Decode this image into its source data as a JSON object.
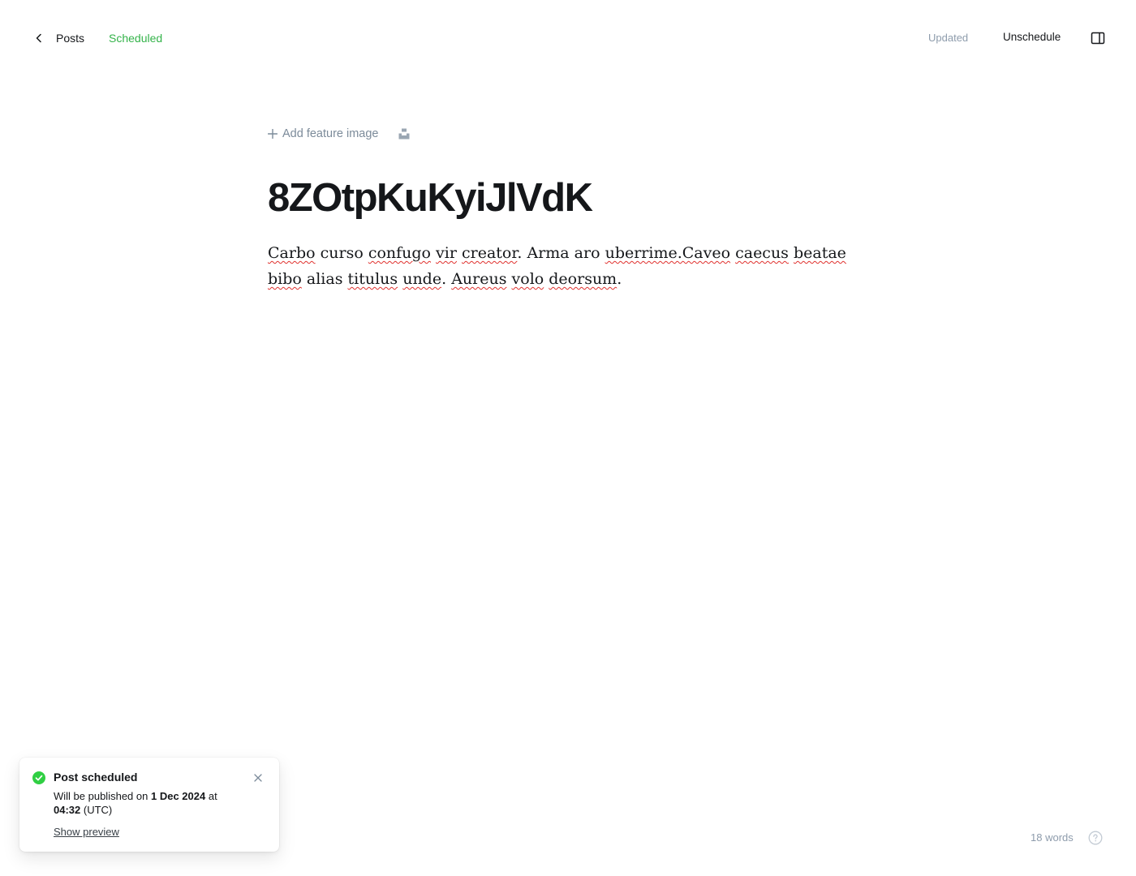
{
  "header": {
    "back_label": "Posts",
    "status": "Scheduled",
    "saved_state": "Updated",
    "unschedule_label": "Unschedule"
  },
  "editor": {
    "add_feature_image_label": "Add feature image",
    "title": "8ZOtpKuKyiJlVdK",
    "body_text": "Carbo curso confugo vir creator. Arma aro uberrime.Caveo caecus beatae bibo alias titulus unde. Aureus volo deorsum."
  },
  "toast": {
    "title": "Post scheduled",
    "message_prefix": "Will be published on",
    "date": "1 Dec 2024",
    "at_word": "at",
    "time": "04:32",
    "timezone": "(UTC)",
    "link_label": "Show preview"
  },
  "footer": {
    "word_count": "18 words"
  },
  "colors": {
    "status_green": "#34b34a",
    "muted": "#8e9cac",
    "text": "#15171a"
  },
  "icons": {
    "back": "chevron-left-icon",
    "settings_toggle": "sidebar-panel-icon",
    "add": "plus-icon",
    "unsplash": "unsplash-icon",
    "toast_status": "check-circle-icon",
    "close": "close-icon",
    "help": "help-circle-icon"
  }
}
